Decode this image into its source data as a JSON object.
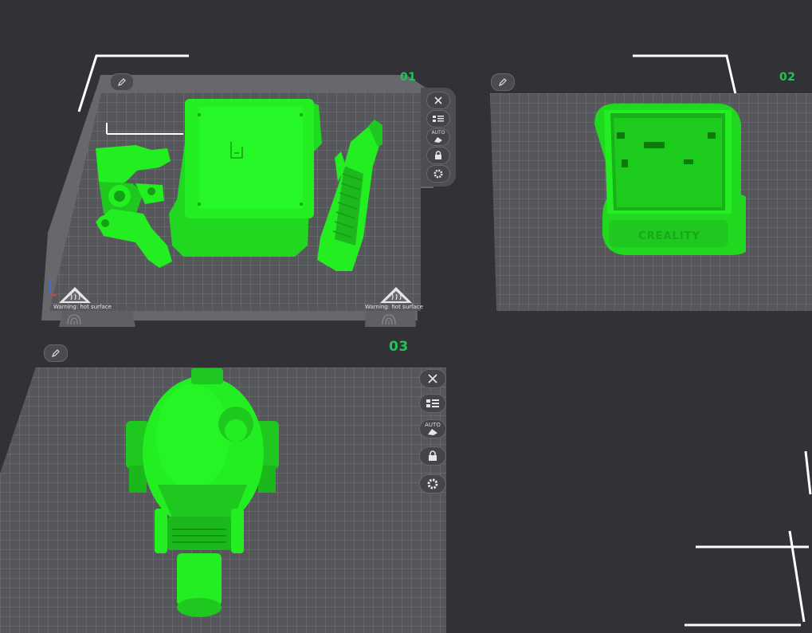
{
  "plates": [
    {
      "number": "01",
      "warning": "Warning: hot surface"
    },
    {
      "number": "02"
    },
    {
      "number": "03"
    }
  ],
  "tools": {
    "auto_label": "AUTO"
  },
  "model_text": {
    "case_brand": "CREALITY"
  },
  "colors": {
    "background": "#323236",
    "plate": "#56575b",
    "model": "#22ee22",
    "plate_number": "#21c45a"
  },
  "icons": [
    "edit-icon",
    "close-icon",
    "arrange-icon",
    "auto-orient-icon",
    "lock-icon",
    "settings-icon",
    "hot-surface-warning-icon",
    "fingerprint-icon"
  ]
}
